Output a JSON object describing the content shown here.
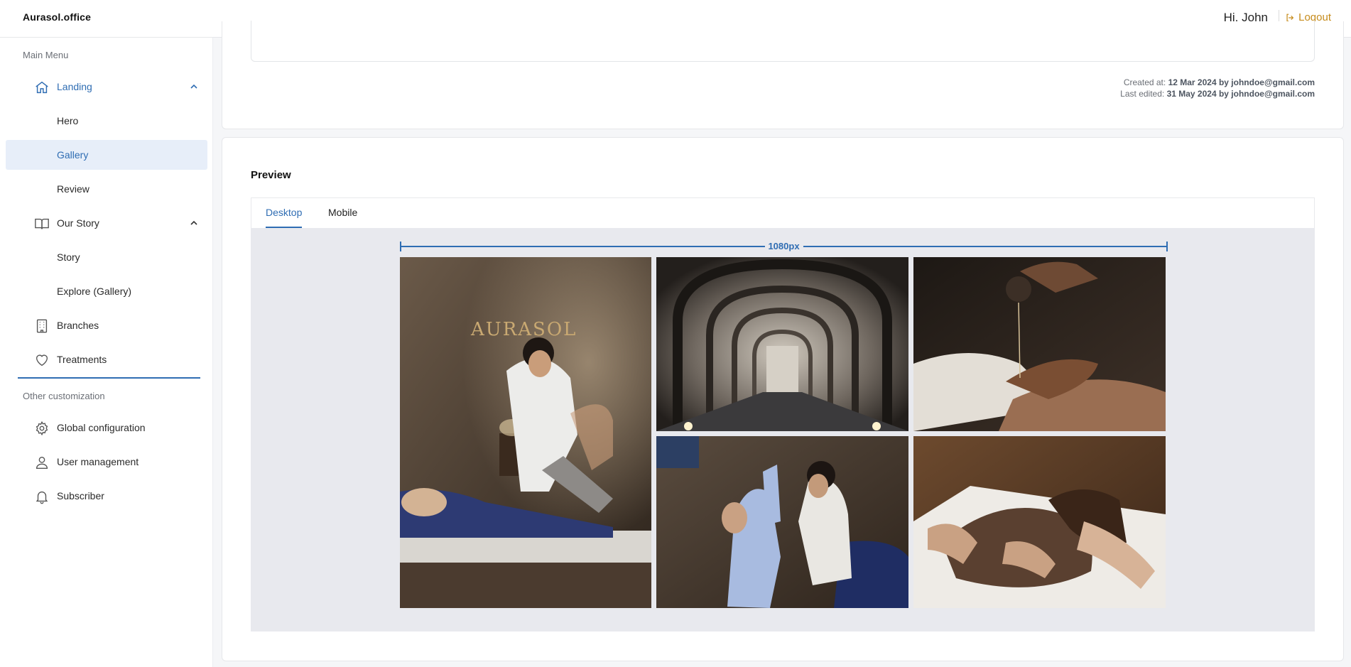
{
  "app": {
    "brand": "Aurasol.office"
  },
  "header": {
    "greeting": "Hi, John",
    "logout_label": "Logout"
  },
  "sidebar": {
    "main_menu_label": "Main Menu",
    "other_label": "Other customization",
    "landing": {
      "label": "Landing",
      "children": [
        "Hero",
        "Gallery",
        "Review"
      ]
    },
    "our_story": {
      "label": "Our Story",
      "children": [
        "Story",
        "Explore (Gallery)"
      ]
    },
    "branches": "Branches",
    "treatments": "Treatments",
    "global_config": "Global configuration",
    "user_management": "User management",
    "subscriber": "Subscriber"
  },
  "record_meta": {
    "created_prefix": "Created at:",
    "created_value": "12 Mar 2024 by johndoe@gmail.com",
    "edited_prefix": "Last edited:",
    "edited_value": "31 May 2024 by johndoe@gmail.com"
  },
  "preview": {
    "title": "Preview",
    "tabs": [
      "Desktop",
      "Mobile"
    ],
    "active_tab": "Desktop",
    "width_label": "1080px",
    "brand_sign": "AURASOL"
  },
  "colors": {
    "accent": "#2f6db3",
    "logout": "#c68b1b",
    "selected_bg": "#e7eef9"
  }
}
